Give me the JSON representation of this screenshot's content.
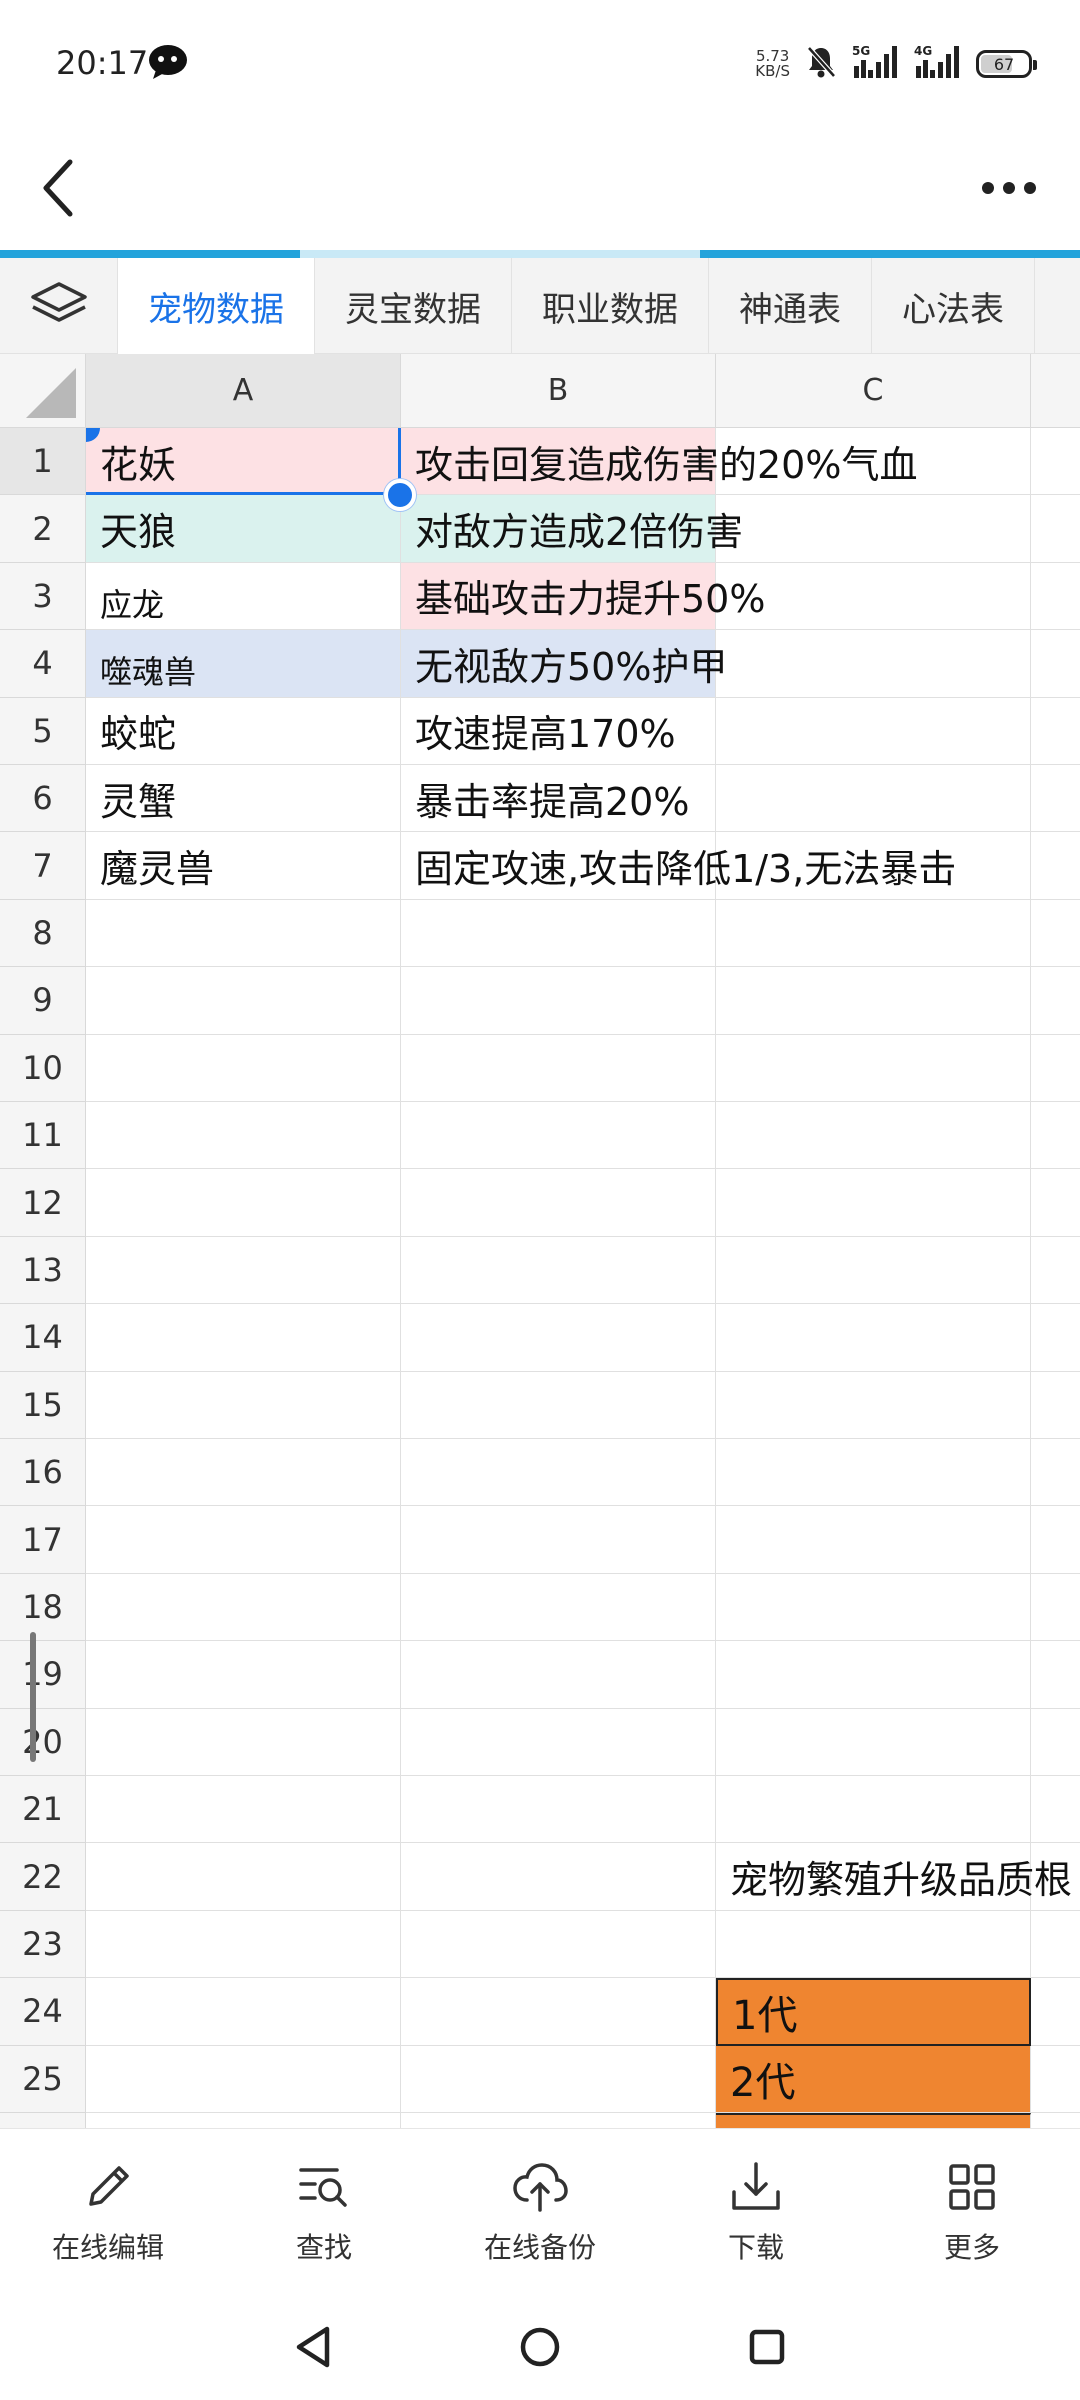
{
  "status": {
    "time": "20:17",
    "speed_value": "5.73",
    "speed_unit": "KB/S",
    "signal1": "5G",
    "signal2": "4G",
    "battery": "67"
  },
  "tabs": [
    {
      "label": "宠物数据",
      "active": true
    },
    {
      "label": "灵宝数据",
      "active": false
    },
    {
      "label": "职业数据",
      "active": false
    },
    {
      "label": "神通表",
      "active": false
    },
    {
      "label": "心法表",
      "active": false
    }
  ],
  "columns": [
    "A",
    "B",
    "C"
  ],
  "rows": [
    "1",
    "2",
    "3",
    "4",
    "5",
    "6",
    "7",
    "8",
    "9",
    "10",
    "11",
    "12",
    "13",
    "14",
    "15",
    "16",
    "17",
    "18",
    "19",
    "20",
    "21",
    "22",
    "23",
    "24",
    "25"
  ],
  "cells": {
    "a1": "花妖",
    "b1": "攻击回复造成伤害的20%气血",
    "a2": "天狼",
    "b2": "对敌方造成2倍伤害",
    "a3": "应龙",
    "b3": "基础攻击力提升50%",
    "a4": "噬魂兽",
    "b4": "无视敌方50%护甲",
    "a5": "蛟蛇",
    "b5": "攻速提高170%",
    "a6": "灵蟹",
    "b6": "暴击率提高20%",
    "a7": "魔灵兽",
    "b7": "固定攻速,攻击降低1/3,无法暴击",
    "c22": "宠物繁殖升级品质根",
    "c24": "1代",
    "c25": "2代"
  },
  "toolbar": {
    "edit": "在线编辑",
    "find": "查找",
    "backup": "在线备份",
    "download": "下载",
    "more": "更多"
  },
  "colors": {
    "accent": "#1a73e8",
    "pink": "#fde1e4",
    "mint": "#daf2ee",
    "lavender": "#dbe4f4",
    "orange": "#ef8530"
  }
}
